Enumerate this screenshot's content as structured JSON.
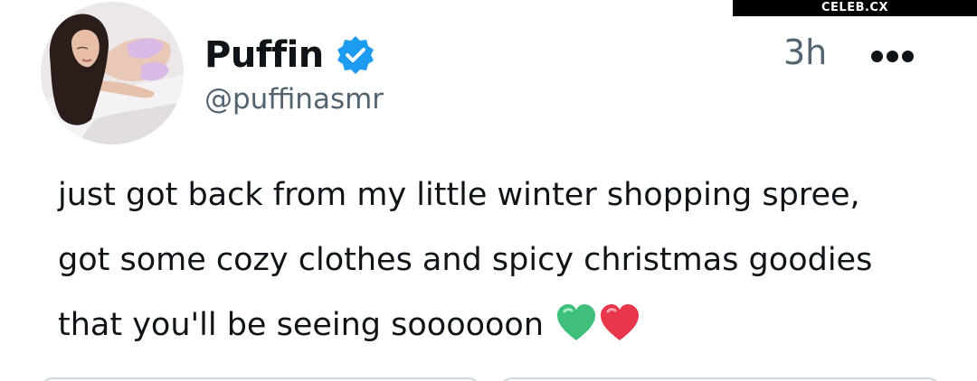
{
  "watermark": "CELEB.CX",
  "author": {
    "display_name": "Puffin",
    "handle": "@puffinasmr",
    "verified_icon": "verified-badge-icon",
    "badge_color": "#1d9bf0",
    "avatar_icon": "profile-photo"
  },
  "timestamp": "3h",
  "more_icon": "more-options-icon",
  "tweet": {
    "lines": [
      "just got back from my little winter shopping spree,",
      "got some cozy clothes and spicy christmas goodies",
      "that you'll be seeing soooooon"
    ],
    "emojis": [
      "green-heart-icon",
      "red-heart-icon"
    ]
  },
  "colors": {
    "text_primary": "#0f1419",
    "text_secondary": "#536471",
    "background": "#ffffff"
  }
}
